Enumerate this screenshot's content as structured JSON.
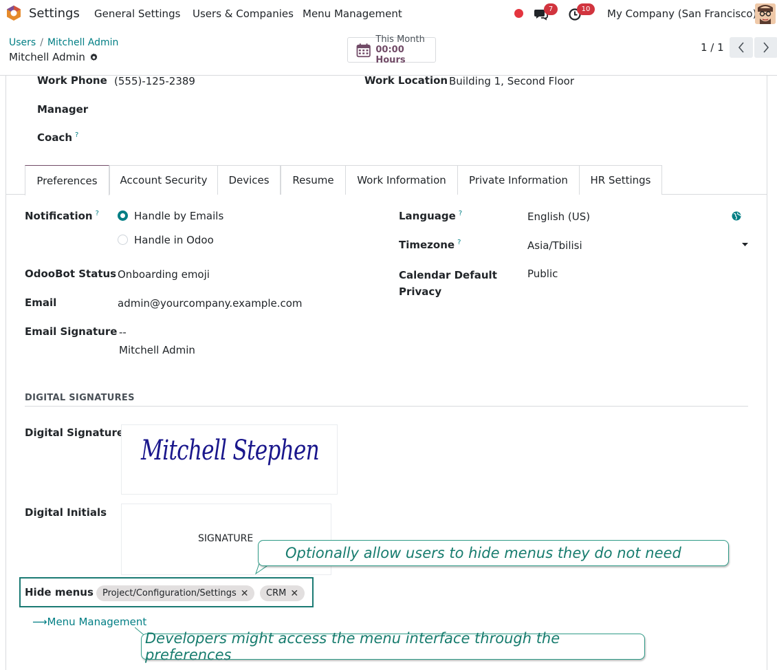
{
  "navbar": {
    "app_name": "Settings",
    "menus": [
      "General Settings",
      "Users & Companies",
      "Menu Management"
    ],
    "chat_count": "7",
    "activity_count": "10",
    "company": "My Company (San Francisco)"
  },
  "control_panel": {
    "breadcrumb_root": "Users",
    "breadcrumb_sep": "/",
    "breadcrumb_current": "Mitchell Admin",
    "record_title": "Mitchell Admin",
    "month_label": "This Month",
    "month_hours": "00:00 Hours",
    "pager": "1 / 1"
  },
  "top_fields": {
    "work_phone_label": "Work Phone",
    "work_phone_value": "(555)-125-2389",
    "work_location_label": "Work Location",
    "work_location_value": "Building 1, Second Floor",
    "manager_label": "Manager",
    "coach_label": "Coach",
    "help_mark": "?"
  },
  "tabs": [
    {
      "label": "Preferences",
      "active": true
    },
    {
      "label": "Account Security",
      "active": false
    },
    {
      "label": "Devices",
      "active": false
    },
    {
      "label": "Resume",
      "active": false
    },
    {
      "label": "Work Information",
      "active": false
    },
    {
      "label": "Private Information",
      "active": false
    },
    {
      "label": "HR Settings",
      "active": false
    }
  ],
  "preferences": {
    "notification_label": "Notification",
    "notification_options": [
      "Handle by Emails",
      "Handle in Odoo"
    ],
    "notification_selected": "Handle by Emails",
    "odoobot_label": "OdooBot Status",
    "odoobot_value": "Onboarding emoji",
    "email_label": "Email",
    "email_value": "admin@yourcompany.example.com",
    "signature_label": "Email Signature",
    "signature_line1": "--",
    "signature_line2": "Mitchell Admin",
    "language_label": "Language",
    "language_value": "English (US)",
    "timezone_label": "Timezone",
    "timezone_value": "Asia/Tbilisi",
    "privacy_label_line1": "Calendar Default",
    "privacy_label_line2": "Privacy",
    "privacy_value": "Public"
  },
  "digital_signatures": {
    "section_title": "DIGITAL SIGNATURES",
    "signature_label": "Digital Signature",
    "signature_drawing": "Mitchell Stephen",
    "initials_label": "Digital Initials",
    "initials_placeholder": "SIGNATURE"
  },
  "hide_menus": {
    "label": "Hide menus",
    "tags": [
      "Project/Configuration/Settings",
      "CRM"
    ],
    "remove_glyph": "✕"
  },
  "menu_link": "⟶Menu Management",
  "callouts": {
    "hide_menus": "Optionally allow users to hide menus they do not need",
    "developers": "Developers might access the menu interface through the preferences"
  },
  "colors": {
    "primary": "#714b67",
    "link": "#017e84",
    "badge": "#d1343e",
    "callout_text": "#177c6e"
  }
}
